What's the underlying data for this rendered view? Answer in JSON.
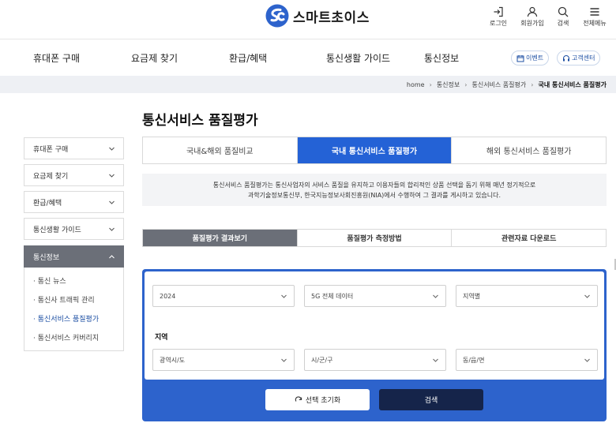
{
  "brand": {
    "name": "스마트초이스",
    "color": "#2d63cc",
    "icon": "sc-logo"
  },
  "utility": [
    {
      "label": "로그인",
      "icon": "login-icon"
    },
    {
      "label": "회원가입",
      "icon": "user-icon"
    },
    {
      "label": "검색",
      "icon": "search-icon"
    },
    {
      "label": "전체메뉴",
      "icon": "menu-icon"
    }
  ],
  "gnb": {
    "items": [
      "휴대폰 구매",
      "요금제 찾기",
      "환급/혜택",
      "통신생활 가이드",
      "통신정보"
    ],
    "event_label": "이벤트",
    "center_label": "고객센터"
  },
  "breadcrumb": {
    "home": "home",
    "level1": "통신정보",
    "level2": "통신서비스 품질평가",
    "current": "국내 통신서비스 품질평가"
  },
  "page_title": "통신서비스 품질평가",
  "sidebar": {
    "items": [
      "휴대폰 구매",
      "요금제 찾기",
      "환급/혜택",
      "통신생활 가이드"
    ],
    "active": "통신정보",
    "sub": [
      "통신 뉴스",
      "통신사 트래픽 관리",
      "통신서비스 품질평가",
      "통신서비스 커버리지"
    ],
    "sub_active_index": 2
  },
  "tabs": [
    "국내&해외 품질비교",
    "국내 통신서비스 품질평가",
    "해외 통신서비스 품질평가"
  ],
  "active_tab_index": 1,
  "intro": {
    "line1": "통신서비스 품질평가는 통신사업자의 서비스 품질을 유지하고 이용자들의 합리적인 상품 선택을 돕기 위해 매년 정기적으로",
    "line2": "과학기술정보통신부, 한국지능정보사회진흥원(NIA)에서 수행하여 그 결과를 게시하고 있습니다."
  },
  "subtabs": [
    "품질평가 결과보기",
    "품질평가 측정방법",
    "관련자료 다운로드"
  ],
  "active_subtab_index": 0,
  "filters": {
    "year": "2024",
    "service": "5G 전체 데이터",
    "scope": "지역별",
    "region_label": "지역",
    "sido_placeholder": "광역시/도",
    "sigungu_placeholder": "시/군/구",
    "dong_placeholder": "동/읍/면"
  },
  "actions": {
    "reset_label": "선택 초기화",
    "search_label": "검색"
  },
  "colors": {
    "primary": "#2d63cc",
    "tab_active": "#2462d6",
    "dark_button": "#15244a",
    "gray_active": "#6b6f78"
  }
}
